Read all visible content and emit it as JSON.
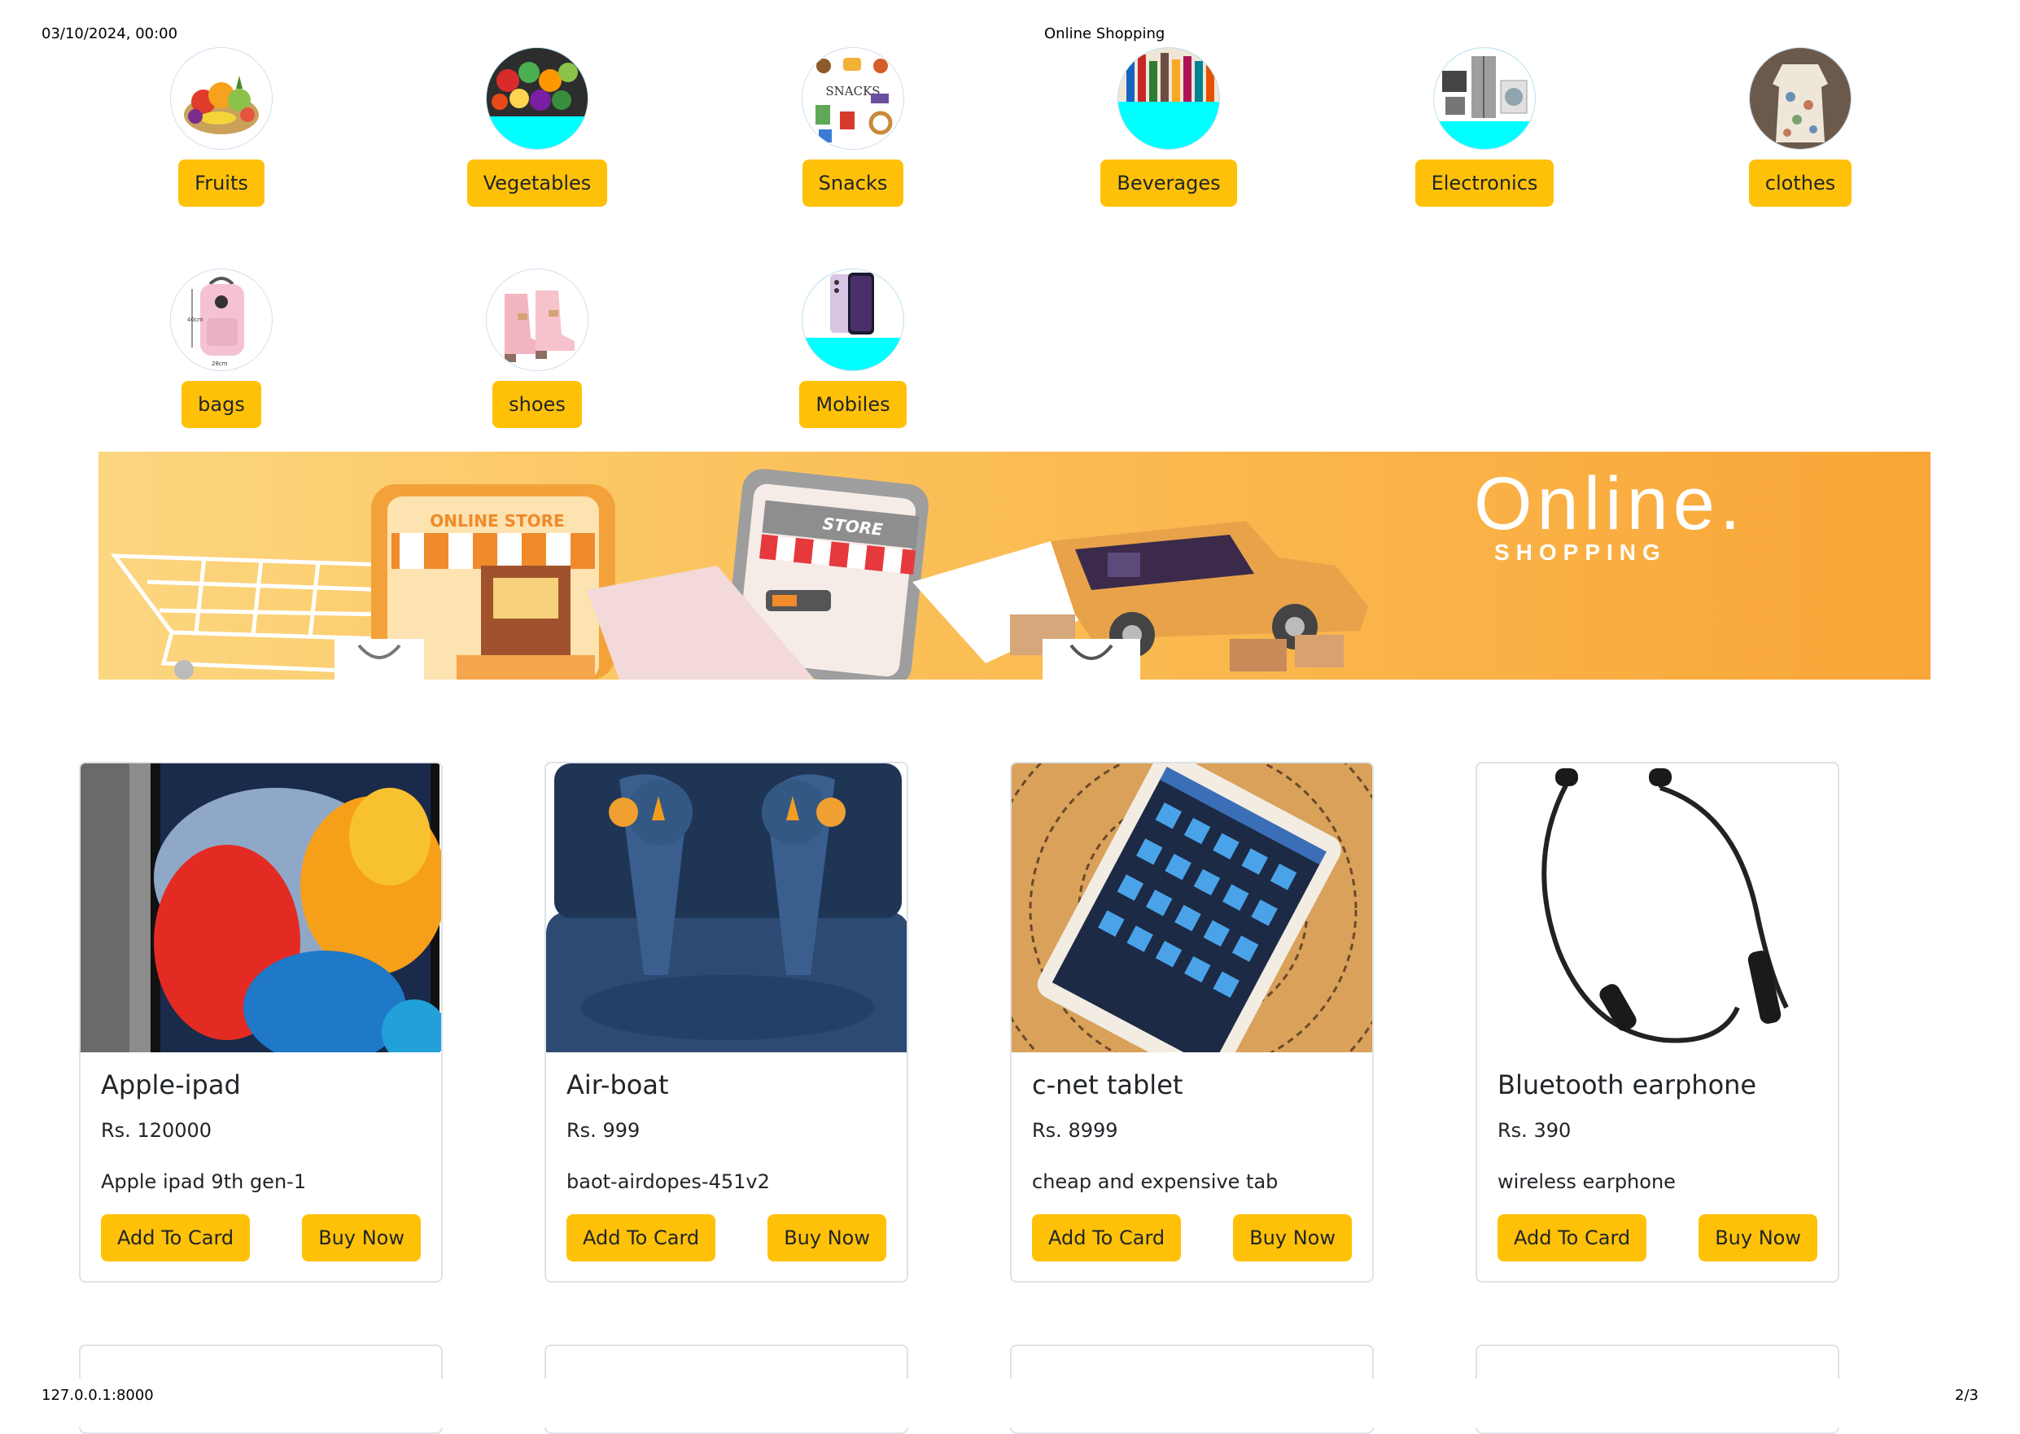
{
  "print_header": {
    "datetime": "03/10/2024, 00:00",
    "title": "Online Shopping"
  },
  "print_footer": {
    "url": "127.0.0.1:8000",
    "page": "2/3"
  },
  "categories": [
    {
      "label": "Fruits",
      "icon": "fruit-basket-image"
    },
    {
      "label": "Vegetables",
      "icon": "vegetables-image"
    },
    {
      "label": "Snacks",
      "icon": "snacks-image"
    },
    {
      "label": "Beverages",
      "icon": "beverages-image"
    },
    {
      "label": "Electronics",
      "icon": "electronics-image"
    },
    {
      "label": "clothes",
      "icon": "clothes-image"
    },
    {
      "label": "bags",
      "icon": "bag-image"
    },
    {
      "label": "shoes",
      "icon": "shoes-image"
    },
    {
      "label": "Mobiles",
      "icon": "mobile-image"
    }
  ],
  "banner": {
    "headline": "Online.",
    "subline": "SHOPPING",
    "store_sign": "ONLINE STORE",
    "phone_sign": "STORE"
  },
  "products": [
    {
      "name": "Apple-ipad",
      "price": "Rs. 120000",
      "description": "Apple ipad 9th gen-1",
      "add_label": "Add To Card",
      "buy_label": "Buy Now"
    },
    {
      "name": "Air-boat",
      "price": "Rs. 999",
      "description": "baot-airdopes-451v2",
      "add_label": "Add To Card",
      "buy_label": "Buy Now"
    },
    {
      "name": "c-net tablet",
      "price": "Rs. 8999",
      "description": "cheap and expensive tab",
      "add_label": "Add To Card",
      "buy_label": "Buy Now"
    },
    {
      "name": "Bluetooth earphone",
      "price": "Rs. 390",
      "description": "wireless earphone",
      "add_label": "Add To Card",
      "buy_label": "Buy Now"
    }
  ],
  "colors": {
    "accent": "#ffc107",
    "card_border": "#dee2e6",
    "circle_fill": "#00ffff"
  }
}
